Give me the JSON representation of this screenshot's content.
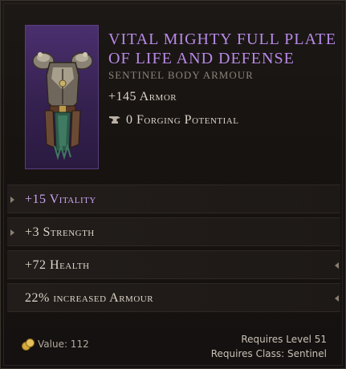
{
  "item": {
    "name": "Vital Mighty Full Plate of Life and Defense",
    "type": "Sentinel Body Armour",
    "armor": "+145 Armor",
    "forging": "0 Forging Potential"
  },
  "affixes": [
    {
      "label": "+15 Vitality",
      "highlight": true,
      "tier_left": true,
      "tier_right": false
    },
    {
      "label": "+3 Strength",
      "highlight": false,
      "tier_left": true,
      "tier_right": false
    },
    {
      "label": "+72 Health",
      "highlight": false,
      "tier_left": false,
      "tier_right": true
    },
    {
      "label": "22% increased Armour",
      "highlight": false,
      "tier_left": false,
      "tier_right": true
    }
  ],
  "footer": {
    "value": "Value: 112",
    "requires_level": "Requires Level 51",
    "requires_class": "Requires Class: Sentinel"
  },
  "colors": {
    "name": "#b78ae6",
    "highlight_affix": "#c9a4ef",
    "art_background": "#35214f",
    "text": "#ddd5c8"
  },
  "icons": {
    "forging": "anvil-icon",
    "value": "gold-coins-icon",
    "tier_marker": "tier-arrow-icon"
  }
}
